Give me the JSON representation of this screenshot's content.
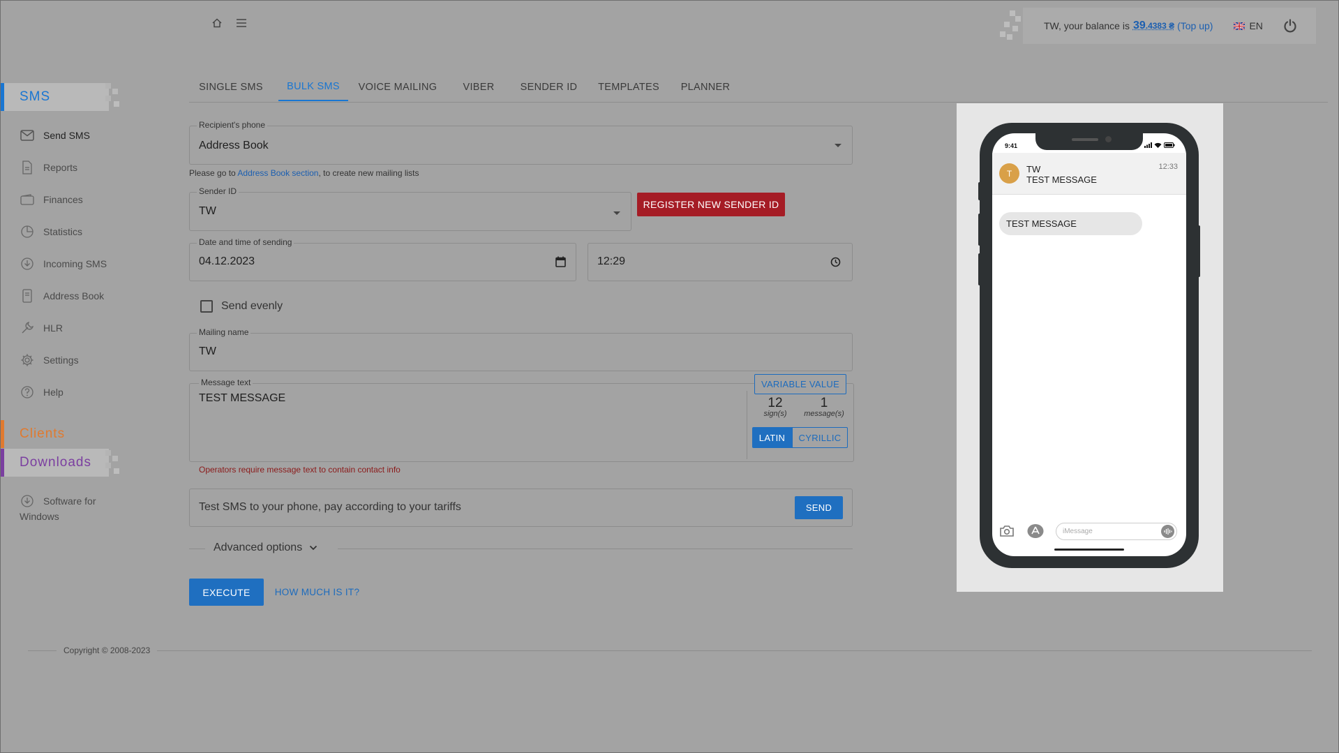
{
  "header": {
    "balance_prefix": "TW, your balance is",
    "balance_int": "39",
    "balance_dec": ".4383 ₴",
    "topup_label": "(Top up)",
    "language": "EN"
  },
  "sidebar": {
    "sections": {
      "sms": "SMS",
      "clients": "Clients",
      "downloads": "Downloads"
    },
    "sms_items": [
      {
        "label": "Send SMS"
      },
      {
        "label": "Reports"
      },
      {
        "label": "Finances"
      },
      {
        "label": "Statistics"
      },
      {
        "label": "Incoming SMS"
      },
      {
        "label": "Address Book"
      },
      {
        "label": "HLR"
      },
      {
        "label": "Settings"
      },
      {
        "label": "Help"
      }
    ],
    "downloads_items": [
      {
        "label_line1": "Software for",
        "label_line2": "Windows"
      }
    ],
    "copyright": "Copyright © 2008-2023"
  },
  "tabs": [
    {
      "label": "SINGLE SMS"
    },
    {
      "label": "BULK SMS"
    },
    {
      "label": "VOICE MAILING"
    },
    {
      "label": "VIBER"
    },
    {
      "label": "SENDER ID"
    },
    {
      "label": "TEMPLATES"
    },
    {
      "label": "PLANNER"
    }
  ],
  "form": {
    "recipient": {
      "label": "Recipient's phone",
      "value": "Address Book"
    },
    "address_hint": {
      "before": "Please go to ",
      "link": "Address Book section",
      "after": ", to create new mailing lists"
    },
    "sender": {
      "label": "Sender ID",
      "value": "TW"
    },
    "register_button": "REGISTER NEW SENDER ID",
    "datetime": {
      "label": "Date and time of sending",
      "date": "04.12.2023",
      "time": "12:29"
    },
    "send_evenly": "Send evenly",
    "mailing_name": {
      "label": "Mailing name",
      "value": "TW"
    },
    "message": {
      "label": "Message text",
      "value": "TEST MESSAGE",
      "variable_button": "VARIABLE VALUE",
      "signs_count": "12",
      "signs_label": "sign(s)",
      "messages_count": "1",
      "messages_label": "message(s)",
      "latin_label": "LATIN",
      "cyrillic_label": "CYRILLIC"
    },
    "message_warning": "Operators require message text to contain contact info",
    "test_sms": {
      "placeholder": "Test SMS to your phone, pay according to your tariffs",
      "send_label": "SEND"
    },
    "advanced_label": "Advanced options",
    "execute_label": "EXECUTE",
    "how_much_label": "HOW MUCH IS IT?"
  },
  "phone": {
    "status_time": "9:41",
    "avatar_letter": "T",
    "sender": "TW",
    "preview_text": "TEST MESSAGE",
    "msg_time": "12:33",
    "bubble_text": "TEST MESSAGE",
    "input_placeholder": "iMessage"
  },
  "colors": {
    "accent_blue": "#1976d2",
    "register_red": "#a51c25",
    "clients_orange": "#e07a2f",
    "downloads_purple": "#7b3fa0",
    "avatar": "#d9a048"
  }
}
